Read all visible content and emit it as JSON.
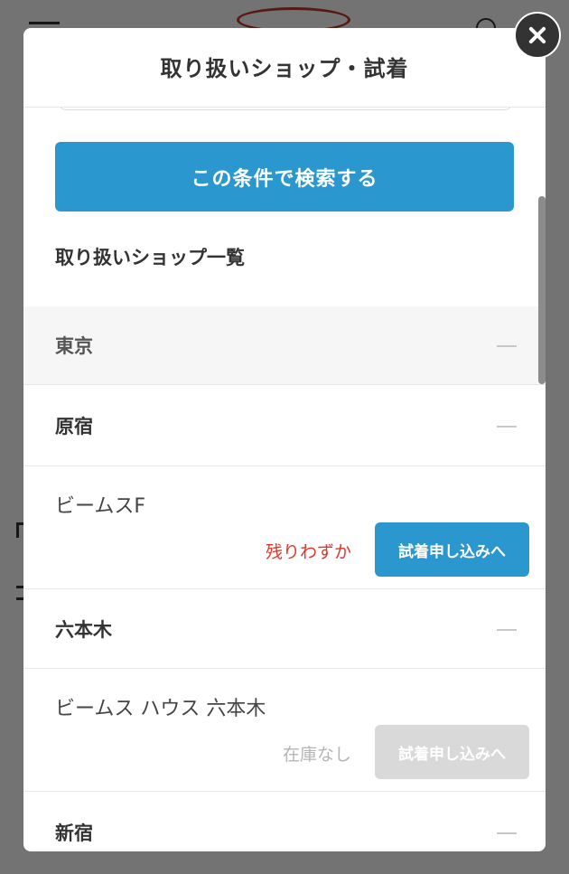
{
  "modal": {
    "title": "取り扱いショップ・試着",
    "search_button_label": "この条件で検索する",
    "shop_list_heading": "取り扱いショップ一覧"
  },
  "areas": [
    {
      "name": "東京",
      "districts": [
        {
          "name": "原宿",
          "shops": [
            {
              "name": "ビームスF",
              "stock": "残りわずか",
              "button": "試着申し込みへ",
              "available": true
            }
          ]
        },
        {
          "name": "六本木",
          "shops": [
            {
              "name": "ビームス ハウス 六本木",
              "stock": "在庫なし",
              "button": "試着申し込みへ",
              "available": false
            }
          ]
        },
        {
          "name": "新宿",
          "shops": []
        }
      ]
    }
  ],
  "icons": {
    "close": "close-icon",
    "collapse": "minus-icon",
    "menu": "hamburger-icon",
    "user": "user-icon"
  },
  "colors": {
    "primary_button": "#2b97cf",
    "low_stock_text": "#e0352b",
    "disabled_button": "#d9d9d9",
    "out_of_stock_text": "#b5b5b5"
  }
}
